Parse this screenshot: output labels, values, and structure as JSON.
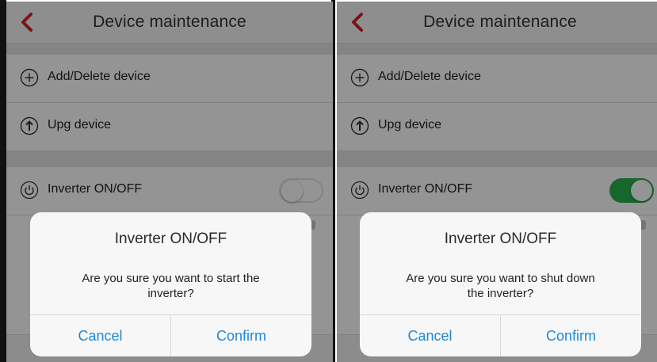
{
  "screens": [
    {
      "header": {
        "title": "Device maintenance"
      },
      "items": [
        {
          "icon": "plus-circle-icon",
          "label": "Add/Delete device"
        },
        {
          "icon": "arrow-up-circle-icon",
          "label": "Upg device"
        },
        {
          "icon": "power-icon",
          "label": "Inverter ON/OFF"
        }
      ],
      "toggle": {
        "state": "off"
      },
      "dialog": {
        "title": "Inverter ON/OFF",
        "message": "Are you sure you want to start the inverter?",
        "cancel_label": "Cancel",
        "confirm_label": "Confirm"
      }
    },
    {
      "header": {
        "title": "Device maintenance"
      },
      "items": [
        {
          "icon": "plus-circle-icon",
          "label": "Add/Delete device"
        },
        {
          "icon": "arrow-up-circle-icon",
          "label": "Upg device"
        },
        {
          "icon": "power-icon",
          "label": "Inverter ON/OFF"
        }
      ],
      "toggle": {
        "state": "on"
      },
      "dialog": {
        "title": "Inverter ON/OFF",
        "message": "Are you sure you want to shut down the inverter?",
        "cancel_label": "Cancel",
        "confirm_label": "Confirm"
      }
    }
  ],
  "colors": {
    "back_arrow": "#d0212a",
    "toggle_on": "#27b24a",
    "dialog_button": "#1f88d8"
  }
}
